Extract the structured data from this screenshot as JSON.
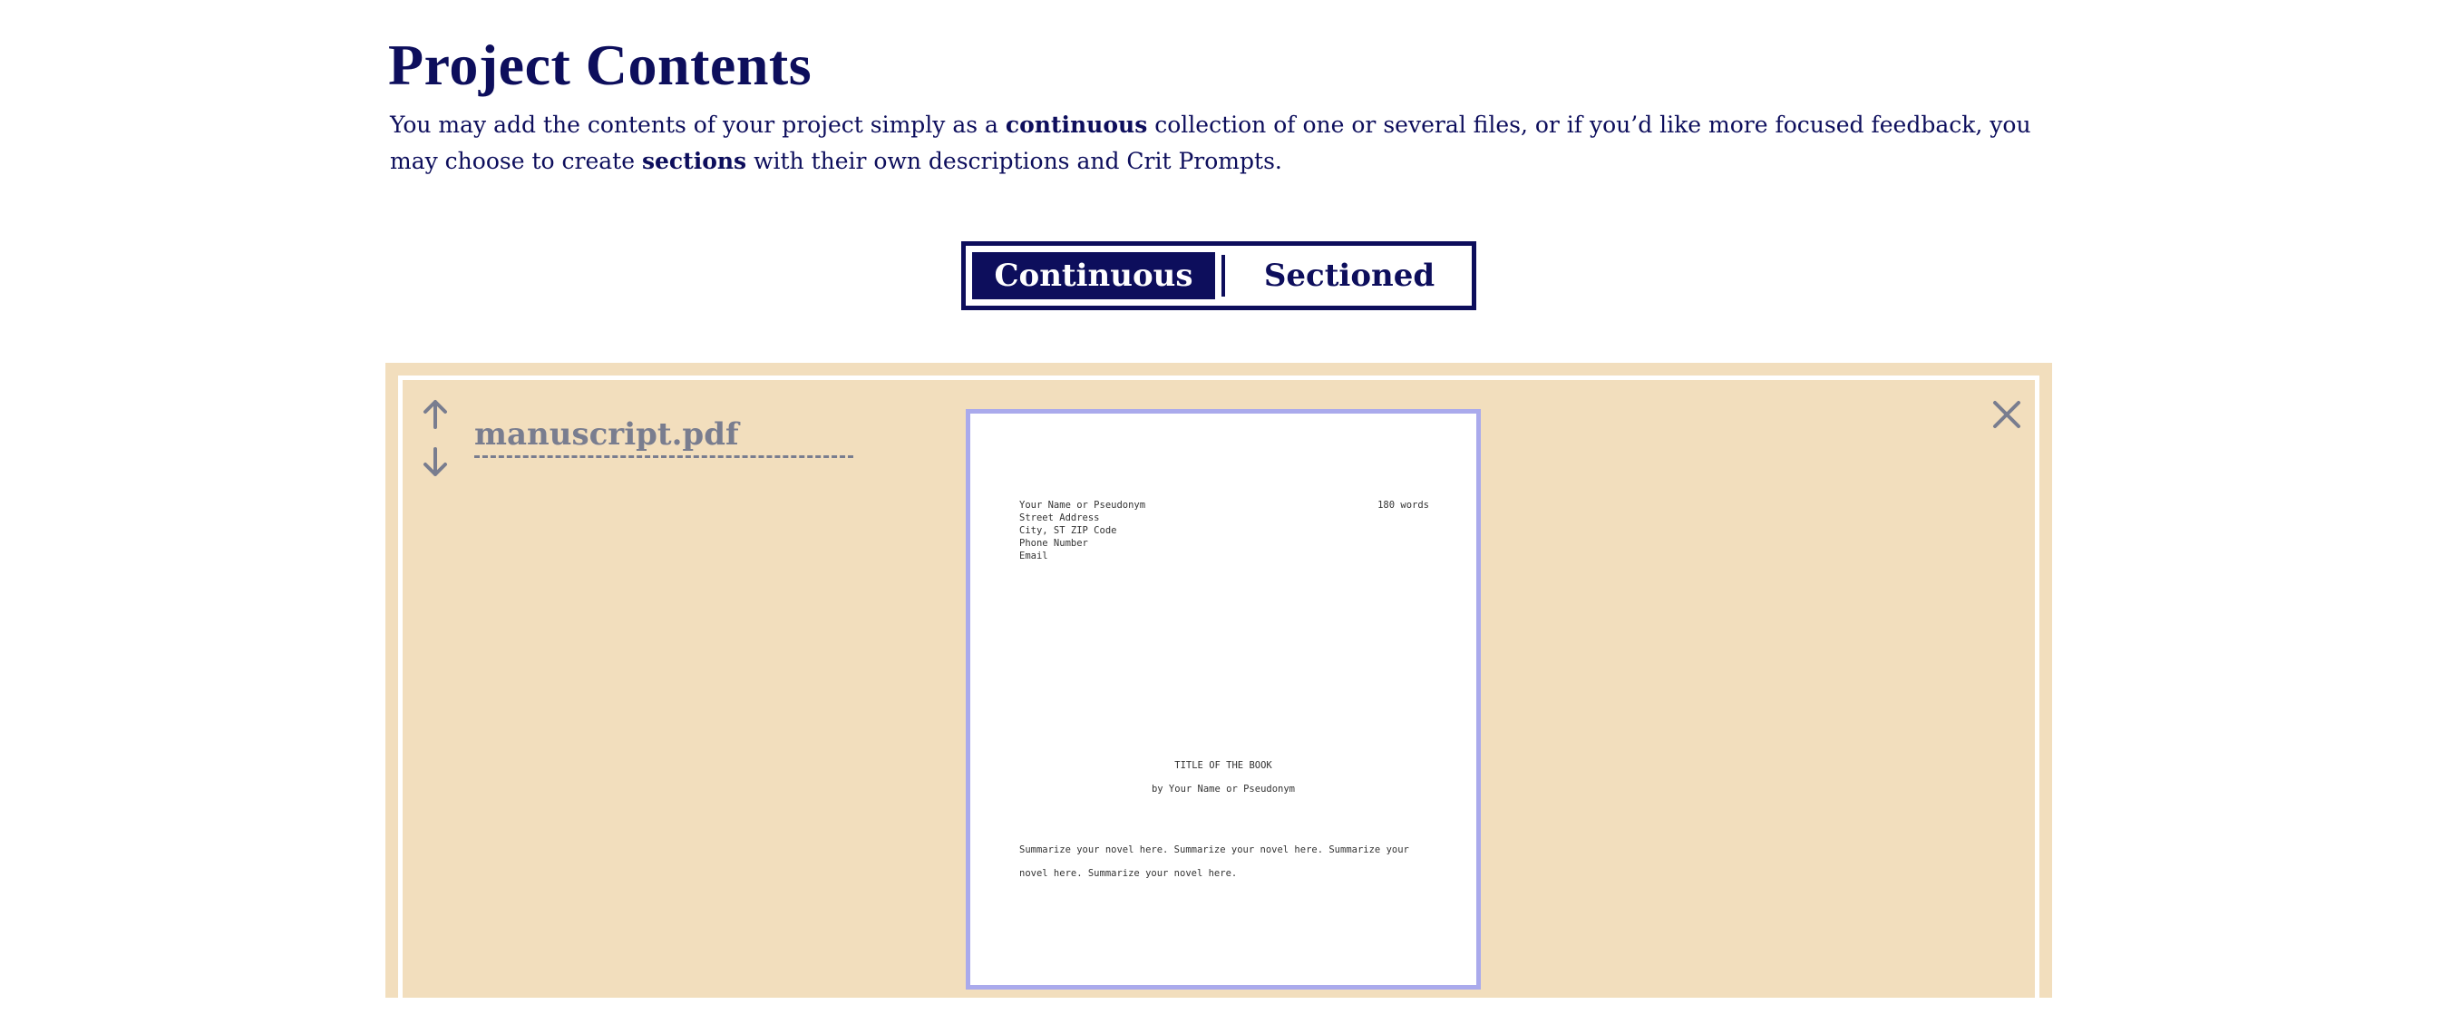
{
  "heading": {
    "title": "Project Contents",
    "intro_prefix": "You may add the contents of your project simply as a ",
    "intro_bold1": "continuous",
    "intro_middle": " collection of one or several files, or if you’d like more focused feedback, you may choose to create ",
    "intro_bold2": "sections",
    "intro_suffix": " with their own descriptions and Crit Prompts."
  },
  "toggle": {
    "options": [
      "Continuous",
      "Sectioned"
    ],
    "selected": "Continuous"
  },
  "file": {
    "name": "manuscript.pdf",
    "icons": {
      "up": "arrow-up-icon",
      "down": "arrow-down-icon",
      "remove": "close-icon"
    }
  },
  "preview": {
    "address_lines": [
      "Your Name or Pseudonym",
      "Street Address",
      "City, ST ZIP Code",
      "Phone Number",
      "Email"
    ],
    "word_count": "180 words",
    "book_title": "TITLE OF THE BOOK",
    "book_byline": "by Your Name or Pseudonym",
    "summary": "Summarize your novel here.  Summarize your novel here.  Summarize your novel here.  Summarize your novel here."
  },
  "colors": {
    "accent": "#0d0e5c",
    "panel_background": "#f2debd",
    "preview_border": "#aaaaec",
    "muted": "#797d8f"
  }
}
